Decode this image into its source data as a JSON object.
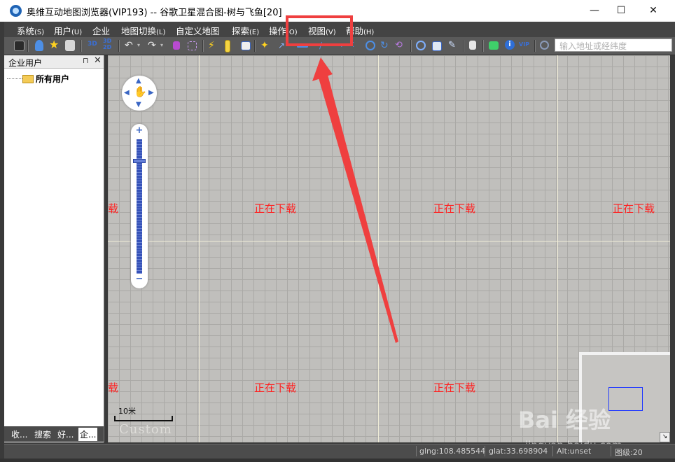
{
  "window": {
    "title": "奥维互动地图浏览器(VIP193) -- 谷歌卫星混合图-树与飞鱼[20]",
    "minimize": "—",
    "maximize": "☐",
    "close": "✕"
  },
  "menu": [
    {
      "label": "系统",
      "acc": "(S)"
    },
    {
      "label": "用户",
      "acc": "(U)"
    },
    {
      "label": "企业",
      "acc": ""
    },
    {
      "label": "地图切换",
      "acc": "(L)"
    },
    {
      "label": "自定义地图",
      "acc": ""
    },
    {
      "label": "探索",
      "acc": "(E)"
    },
    {
      "label": "操作",
      "acc": "(O)"
    },
    {
      "label": "视图",
      "acc": "(V)"
    },
    {
      "label": "帮助",
      "acc": "(H)"
    }
  ],
  "toolbar": {
    "text_3d": "3D",
    "text_3d2d": "3D",
    "text_vip": "VIP",
    "search_placeholder": "输入地址或经纬度"
  },
  "left_panel": {
    "title": "企业用户",
    "pin": "⊓",
    "close": "✕",
    "tree_root": "所有用户",
    "tabs": [
      "收...",
      "搜索",
      "好...",
      "企..."
    ]
  },
  "map": {
    "loading_text": "正在下载",
    "edge_text": "载",
    "scale_label": "10米",
    "custom_label": "Custom",
    "zoom_in": "+",
    "zoom_out": "−",
    "zoom_level_fraction": 0.16,
    "overview_toggle": "↘"
  },
  "status": {
    "glng": "glng:108.485544",
    "glat": "glat:33.698904",
    "alt": "Alt:unset",
    "level": "图级:20"
  },
  "watermark": {
    "brand": "Bai 经验",
    "url": "jingyan.baidu.com"
  },
  "colors": {
    "highlight": "#ef3f3f",
    "loading": "#ff2020",
    "map_bg": "#c0bfbc"
  }
}
